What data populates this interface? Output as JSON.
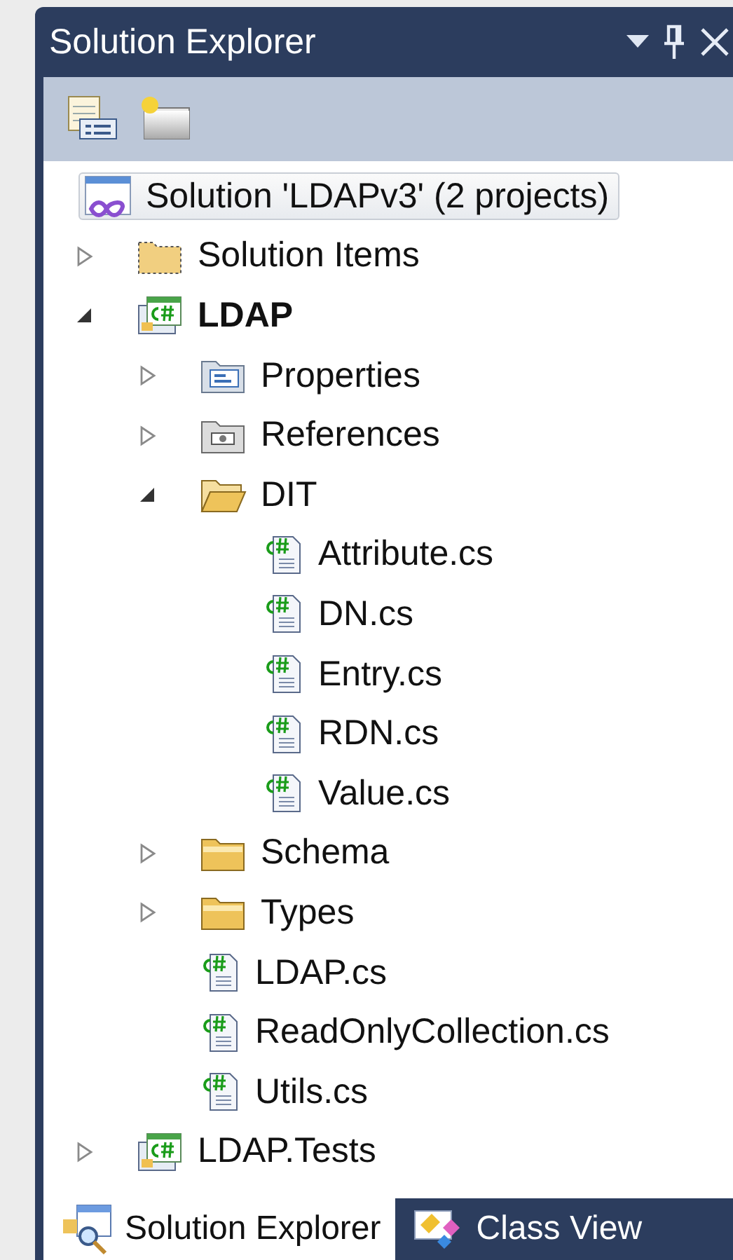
{
  "window": {
    "title": "Solution Explorer"
  },
  "tree": {
    "items": [
      {
        "label": "Solution 'LDAPv3' (2 projects)",
        "kind": "solution",
        "selected": true,
        "children": [
          {
            "label": "Solution Items",
            "kind": "solution-folder",
            "selected": false,
            "expanded": false
          },
          {
            "label": "LDAP",
            "kind": "project",
            "selected": false,
            "startup": true,
            "expanded": true,
            "children": [
              {
                "label": "Properties",
                "kind": "properties",
                "selected": false,
                "expanded": false
              },
              {
                "label": "References",
                "kind": "references",
                "selected": false,
                "expanded": false
              },
              {
                "label": "DIT",
                "kind": "folder",
                "selected": false,
                "expanded": true,
                "children": [
                  {
                    "label": "Attribute.cs",
                    "kind": "csfile",
                    "selected": false
                  },
                  {
                    "label": "DN.cs",
                    "kind": "csfile",
                    "selected": false
                  },
                  {
                    "label": "Entry.cs",
                    "kind": "csfile",
                    "selected": false
                  },
                  {
                    "label": "RDN.cs",
                    "kind": "csfile",
                    "selected": false
                  },
                  {
                    "label": "Value.cs",
                    "kind": "csfile",
                    "selected": false
                  }
                ]
              },
              {
                "label": "Schema",
                "kind": "folder",
                "selected": false,
                "expanded": false
              },
              {
                "label": "Types",
                "kind": "folder",
                "selected": false,
                "expanded": false
              },
              {
                "label": "LDAP.cs",
                "kind": "csfile",
                "selected": false
              },
              {
                "label": "ReadOnlyCollection.cs",
                "kind": "csfile",
                "selected": false
              },
              {
                "label": "Utils.cs",
                "kind": "csfile",
                "selected": false
              }
            ]
          },
          {
            "label": "LDAP.Tests",
            "kind": "project",
            "selected": false,
            "startup": false,
            "expanded": false
          }
        ]
      }
    ]
  },
  "bottom_tabs": [
    {
      "label": "Solution Explorer",
      "kind": "solution-explorer",
      "selected": true
    },
    {
      "label": "Class View",
      "kind": "class-view",
      "selected": false
    }
  ]
}
